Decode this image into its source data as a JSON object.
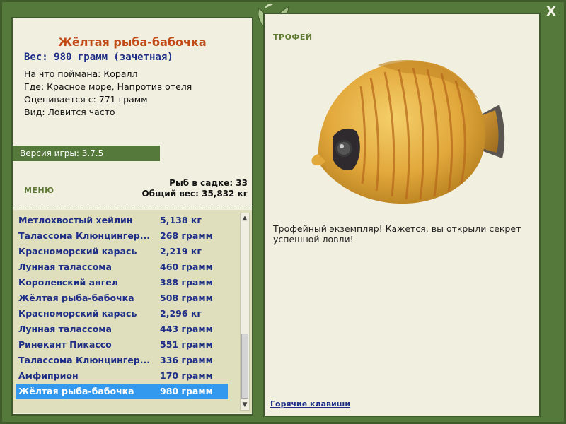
{
  "window": {
    "close_label": "X"
  },
  "catch": {
    "title": "Жёлтая рыба-бабочка",
    "weight_line": "Вес: 980 грамм (зачетная)",
    "info": [
      "На что поймана: Коралл",
      "Где: Красное море, Напротив отеля",
      "Оценивается с: 771 грамм",
      "Вид: Ловится часто"
    ]
  },
  "version": "Версия игры: 3.7.5",
  "menu_label": "МЕНЮ",
  "keep": {
    "count_line": "Рыб в садке: 33",
    "total_line": "Общий вес: 35,832 кг"
  },
  "fish_list": [
    {
      "name": "Метлохвостый хейлин",
      "weight": "5,138 кг"
    },
    {
      "name": "Талассома Клюнцингер...",
      "weight": "268 грамм"
    },
    {
      "name": "Красноморский карась",
      "weight": "2,219 кг"
    },
    {
      "name": "Лунная талассома",
      "weight": "460 грамм"
    },
    {
      "name": "Королевский ангел",
      "weight": "388 грамм"
    },
    {
      "name": "Жёлтая рыба-бабочка",
      "weight": "508 грамм"
    },
    {
      "name": "Красноморский карась",
      "weight": "2,296 кг"
    },
    {
      "name": "Лунная талассома",
      "weight": "443 грамм"
    },
    {
      "name": "Ринекант Пикассо",
      "weight": "551 грамм"
    },
    {
      "name": "Талассома Клюнцингер...",
      "weight": "336 грамм"
    },
    {
      "name": "Амфиприон",
      "weight": "170 грамм"
    },
    {
      "name": "Жёлтая рыба-бабочка",
      "weight": "980 грамм"
    }
  ],
  "selected_index": 11,
  "trophy": {
    "label": "ТРОФЕЙ",
    "text": "Трофейный экземпляр! Кажется, вы открыли секрет успешной ловли!"
  },
  "hotkeys_label": "Горячие клавиши",
  "colors": {
    "frame_green": "#55793a",
    "panel_bg": "#f1f0e0",
    "list_bg": "#dfdfbd",
    "title_orange": "#c24a14",
    "text_blue": "#1e2e86",
    "selection_blue": "#3399ee"
  }
}
